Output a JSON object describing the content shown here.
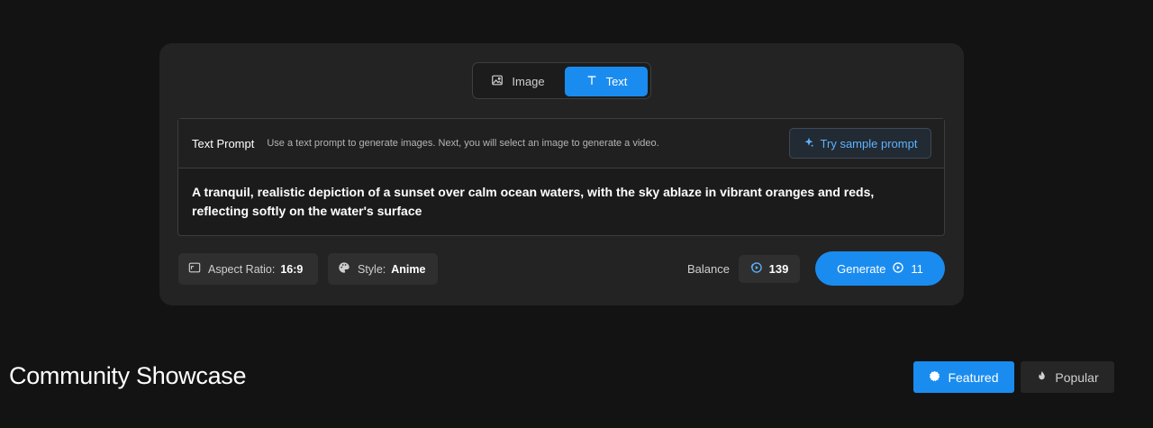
{
  "mode_switch": {
    "image_label": "Image",
    "text_label": "Text",
    "active": "text"
  },
  "prompt": {
    "title": "Text Prompt",
    "hint": "Use a text prompt to generate images. Next, you will select an image to generate a video.",
    "sample_button_label": "Try sample prompt",
    "value": "A tranquil, realistic depiction of a sunset over calm ocean waters, with the sky ablaze in vibrant oranges and reds, reflecting softly on the water's surface"
  },
  "options": {
    "aspect_label": "Aspect Ratio:",
    "aspect_value": "16:9",
    "style_label": "Style:",
    "style_value": "Anime"
  },
  "balance": {
    "label": "Balance",
    "value": "139"
  },
  "generate": {
    "label": "Generate",
    "cost": "11"
  },
  "showcase": {
    "title": "Community Showcase",
    "tabs": [
      {
        "label": "Featured",
        "active": true
      },
      {
        "label": "Popular",
        "active": false
      }
    ]
  },
  "colors": {
    "accent": "#1a8cf0",
    "sample_link": "#5eb3ff",
    "background": "#131313",
    "panel": "#232323"
  }
}
